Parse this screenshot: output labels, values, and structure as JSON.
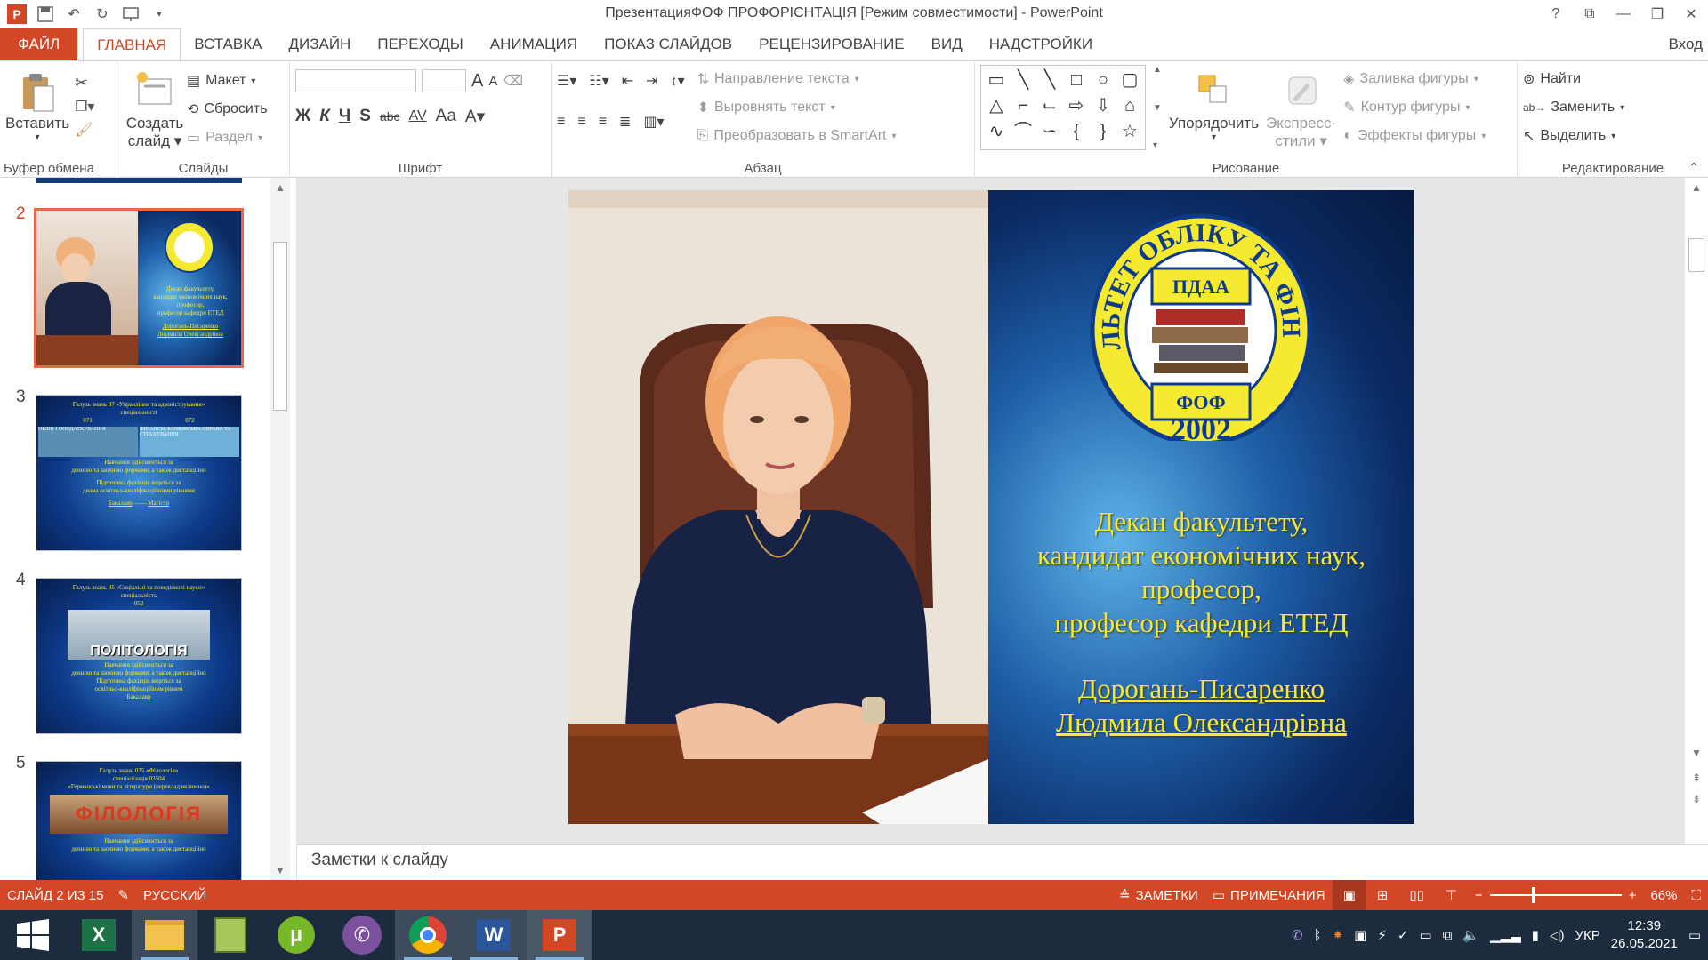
{
  "window": {
    "title": "ПрезентацияФОФ ПРОФОРІЄНТАЦІЯ [Режим совместимости] - PowerPoint",
    "controls": [
      "?",
      "⧉",
      "—",
      "❐",
      "✕"
    ]
  },
  "tabs": [
    "ФАЙЛ",
    "ГЛАВНАЯ",
    "ВСТАВКА",
    "ДИЗАЙН",
    "ПЕРЕХОДЫ",
    "АНИМАЦИЯ",
    "ПОКАЗ СЛАЙДОВ",
    "РЕЦЕНЗИРОВАНИЕ",
    "ВИД",
    "НАДСТРОЙКИ"
  ],
  "signin": "Вход",
  "ribbon": {
    "clipboard": {
      "name": "Буфер обмена",
      "paste": "Вставить"
    },
    "slides": {
      "name": "Слайды",
      "new_slide_1": "Создать",
      "new_slide_2": "слайд",
      "layout": "Макет",
      "reset": "Сбросить",
      "section": "Раздел"
    },
    "font": {
      "name": "Шрифт",
      "bold": "Ж",
      "italic": "К",
      "underline": "Ч",
      "shadow": "S",
      "strike": "abc",
      "spacing": "AV",
      "case": "Aa",
      "grow": "A",
      "shrink": "A"
    },
    "paragraph": {
      "name": "Абзац",
      "text_direction": "Направление текста",
      "align_text": "Выровнять текст",
      "smartart": "Преобразовать в SmartArt"
    },
    "drawing": {
      "name": "Рисование",
      "arrange": "Упорядочить",
      "quick_styles_1": "Экспресс-",
      "quick_styles_2": "стили",
      "fill": "Заливка фигуры",
      "outline": "Контур фигуры",
      "effects": "Эффекты фигуры"
    },
    "editing": {
      "name": "Редактирование",
      "find": "Найти",
      "replace": "Заменить",
      "select": "Выделить"
    }
  },
  "thumbnails": [
    {
      "num": "2",
      "lines": [
        "Декан факультету,",
        "кандидат економічних наук,",
        "професор,",
        "професор кафедри ЕТЕД",
        "Дорогань-Писаренко",
        "Людмила Олександрівна"
      ]
    },
    {
      "num": "3",
      "lines": [
        "Галузь знань 07 «Управління та адміністрування»",
        "спеціальності",
        "071",
        "072",
        "ОБЛІК І ОПОДАТКУВАННЯ",
        "ФІНАНСИ, БАНКІВСЬКА СПРАВА ТА СТРАХУВАННЯ",
        "Навчання здійснюється за",
        "денною та заочною формами, а також дистанційно",
        "Підготовка фахівців ведеться за",
        "двома освітньо-кваліфікаційними рівнями",
        "Бакалавр",
        "Магістр"
      ]
    },
    {
      "num": "4",
      "lines": [
        "Галузь знань 05 «Соціальні та поведінкові науки»",
        "спеціальність",
        "052",
        "ПОЛІТОЛОГІЯ",
        "Навчання здійснюється за",
        "денною та заочною формами, а також дистанційно",
        "Підготовка фахівців ведеться за",
        "освітньо-кваліфікаційним рівнем",
        "Бакалавр"
      ]
    },
    {
      "num": "5",
      "lines": [
        "Галузь знань 035 «Філологія»",
        "спеціалізація 03504",
        "«Германські мови та літератури (переклад включно)»",
        "ФІЛОЛОГІЯ",
        "Навчання здійснюється за",
        "денною та заочною формами, а також дистанційно"
      ]
    }
  ],
  "slide": {
    "logo": {
      "top_text": "ФАКУЛЬТЕТ ОБЛІКУ ТА ФІНАНСІВ",
      "badge_top": "ПДАА",
      "badge_bottom": "ФОФ",
      "year": "2002"
    },
    "lines": [
      "Декан факультету,",
      "кандидат економічних наук,",
      "професор,",
      "професор кафедри ЕТЕД"
    ],
    "name_lines": [
      "Дорогань-Писаренко",
      "Людмила Олександрівна"
    ]
  },
  "notes_placeholder": "Заметки к слайду",
  "status": {
    "slide_info": "СЛАЙД 2 ИЗ 15",
    "language": "РУССКИЙ",
    "notes": "ЗАМЕТКИ",
    "comments": "ПРИМЕЧАНИЯ",
    "zoom": "66%",
    "zoom_value": 0.66
  },
  "taskbar": {
    "lang": "УКР",
    "time": "12:39",
    "date": "26.05.2021"
  },
  "colors": {
    "accent": "#d24726",
    "slide_text": "#f5ea30",
    "taskbar": "#1c2b3d"
  }
}
